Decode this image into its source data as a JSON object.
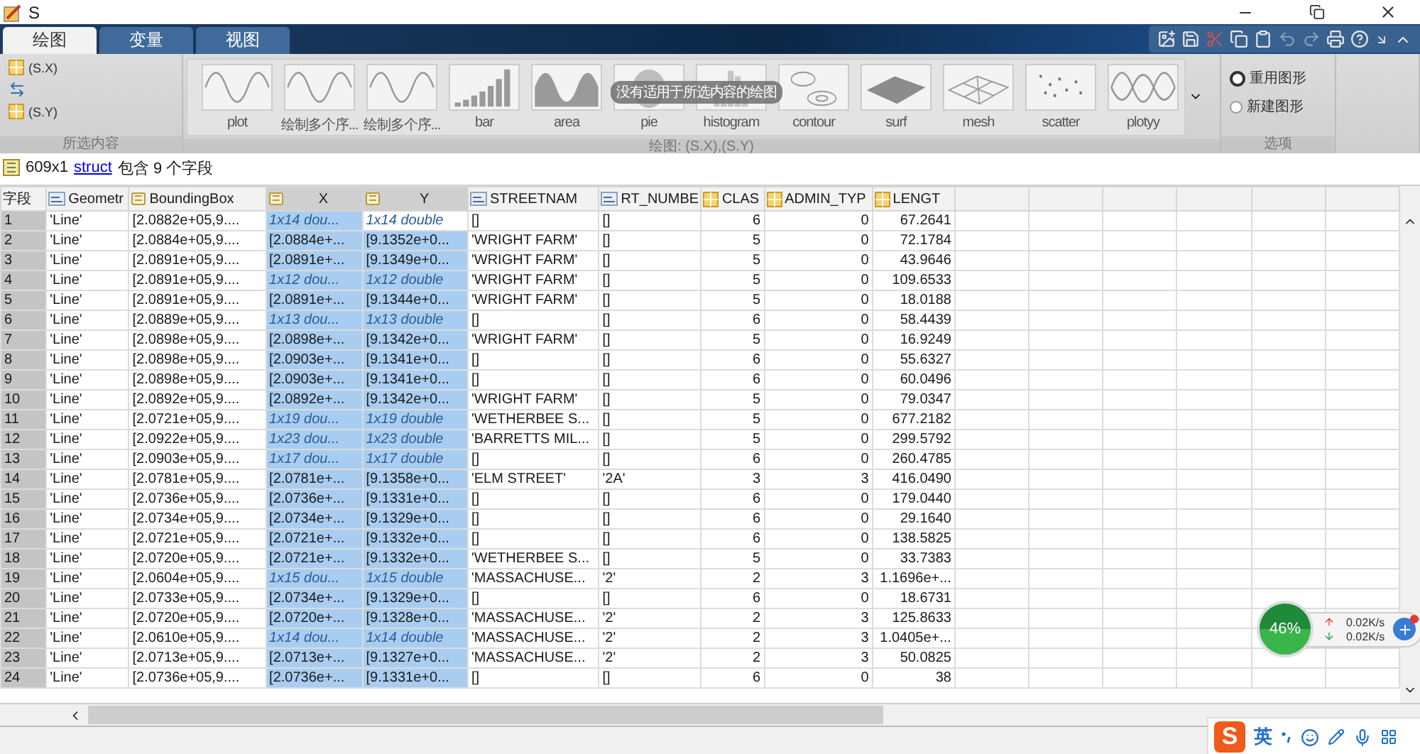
{
  "window": {
    "title": "S"
  },
  "tabs": [
    {
      "label": "绘图",
      "selected": true
    },
    {
      "label": "变量",
      "selected": false
    },
    {
      "label": "视图",
      "selected": false
    }
  ],
  "selection": {
    "items": [
      "(S.X)",
      "(S.Y)"
    ],
    "label": "所选内容"
  },
  "gallery": {
    "label": "绘图: (S.X),(S.Y)",
    "tooltip": "没有适用于所选内容的绘图",
    "items": [
      {
        "label": "plot",
        "kind": "plot"
      },
      {
        "label": "绘制多个序...",
        "kind": "plot"
      },
      {
        "label": "绘制多个序...",
        "kind": "plot"
      },
      {
        "label": "bar",
        "kind": "bar"
      },
      {
        "label": "area",
        "kind": "area"
      },
      {
        "label": "pie",
        "kind": "pie"
      },
      {
        "label": "histogram",
        "kind": "histogram"
      },
      {
        "label": "contour",
        "kind": "contour"
      },
      {
        "label": "surf",
        "kind": "surf"
      },
      {
        "label": "mesh",
        "kind": "mesh"
      },
      {
        "label": "scatter",
        "kind": "scatter"
      },
      {
        "label": "plotyy",
        "kind": "plotyy"
      }
    ]
  },
  "options": {
    "label": "选项",
    "radios": [
      {
        "label": "重用图形",
        "selected": true
      },
      {
        "label": "新建图形",
        "selected": false
      }
    ]
  },
  "info": {
    "size": "609x1",
    "link": "struct",
    "text": "包含 9 个字段"
  },
  "table": {
    "columns": [
      {
        "label": "字段",
        "kind": "index",
        "selected": false
      },
      {
        "label": "Geometr",
        "kind": "char",
        "selected": false
      },
      {
        "label": "BoundingBox",
        "kind": "cell",
        "selected": false
      },
      {
        "label": "X",
        "kind": "cell",
        "selected": true
      },
      {
        "label": "Y",
        "kind": "cell",
        "selected": true
      },
      {
        "label": "STREETNAM",
        "kind": "char",
        "selected": false
      },
      {
        "label": "RT_NUMBE",
        "kind": "char",
        "selected": false
      },
      {
        "label": "CLAS",
        "kind": "numeric",
        "selected": false
      },
      {
        "label": "ADMIN_TYP",
        "kind": "numeric",
        "selected": false
      },
      {
        "label": "LENGT",
        "kind": "numeric",
        "selected": false
      }
    ],
    "rows": [
      {
        "kind": "size",
        "focused": true,
        "cells": [
          "1",
          "'Line'",
          "[2.0882e+05,9....",
          "1x14 dou...",
          "1x14 double",
          "[]",
          "[]",
          "6",
          "0",
          "67.2641"
        ]
      },
      {
        "kind": "value",
        "focused": false,
        "cells": [
          "2",
          "'Line'",
          "[2.0884e+05,9....",
          "[2.0884e+...",
          "[9.1352e+0...",
          "'WRIGHT FARM'",
          "[]",
          "5",
          "0",
          "72.1784"
        ]
      },
      {
        "kind": "value",
        "focused": false,
        "cells": [
          "3",
          "'Line'",
          "[2.0891e+05,9....",
          "[2.0891e+...",
          "[9.1349e+0...",
          "'WRIGHT FARM'",
          "[]",
          "5",
          "0",
          "43.9646"
        ]
      },
      {
        "kind": "size",
        "focused": false,
        "cells": [
          "4",
          "'Line'",
          "[2.0891e+05,9....",
          "1x12 dou...",
          "1x12 double",
          "'WRIGHT FARM'",
          "[]",
          "5",
          "0",
          "109.6533"
        ]
      },
      {
        "kind": "value",
        "focused": false,
        "cells": [
          "5",
          "'Line'",
          "[2.0891e+05,9....",
          "[2.0891e+...",
          "[9.1344e+0...",
          "'WRIGHT FARM'",
          "[]",
          "5",
          "0",
          "18.0188"
        ]
      },
      {
        "kind": "size",
        "focused": false,
        "cells": [
          "6",
          "'Line'",
          "[2.0889e+05,9....",
          "1x13 dou...",
          "1x13 double",
          "[]",
          "[]",
          "6",
          "0",
          "58.4439"
        ]
      },
      {
        "kind": "value",
        "focused": false,
        "cells": [
          "7",
          "'Line'",
          "[2.0898e+05,9....",
          "[2.0898e+...",
          "[9.1342e+0...",
          "'WRIGHT FARM'",
          "[]",
          "5",
          "0",
          "16.9249"
        ]
      },
      {
        "kind": "value",
        "focused": false,
        "cells": [
          "8",
          "'Line'",
          "[2.0898e+05,9....",
          "[2.0903e+...",
          "[9.1341e+0...",
          "[]",
          "[]",
          "6",
          "0",
          "55.6327"
        ]
      },
      {
        "kind": "value",
        "focused": false,
        "cells": [
          "9",
          "'Line'",
          "[2.0898e+05,9....",
          "[2.0903e+...",
          "[9.1341e+0...",
          "[]",
          "[]",
          "6",
          "0",
          "60.0496"
        ]
      },
      {
        "kind": "value",
        "focused": false,
        "cells": [
          "10",
          "'Line'",
          "[2.0892e+05,9....",
          "[2.0892e+...",
          "[9.1342e+0...",
          "'WRIGHT FARM'",
          "[]",
          "5",
          "0",
          "79.0347"
        ]
      },
      {
        "kind": "size",
        "focused": false,
        "cells": [
          "11",
          "'Line'",
          "[2.0721e+05,9....",
          "1x19 dou...",
          "1x19 double",
          "'WETHERBEE S...",
          "[]",
          "5",
          "0",
          "677.2182"
        ]
      },
      {
        "kind": "size",
        "focused": false,
        "cells": [
          "12",
          "'Line'",
          "[2.0922e+05,9....",
          "1x23 dou...",
          "1x23 double",
          "'BARRETTS MIL...",
          "[]",
          "5",
          "0",
          "299.5792"
        ]
      },
      {
        "kind": "size",
        "focused": false,
        "cells": [
          "13",
          "'Line'",
          "[2.0903e+05,9....",
          "1x17 dou...",
          "1x17 double",
          "[]",
          "[]",
          "6",
          "0",
          "260.4785"
        ]
      },
      {
        "kind": "value",
        "focused": false,
        "cells": [
          "14",
          "'Line'",
          "[2.0781e+05,9....",
          "[2.0781e+...",
          "[9.1358e+0...",
          "'ELM STREET'",
          "'2A'",
          "3",
          "3",
          "416.0490"
        ]
      },
      {
        "kind": "value",
        "focused": false,
        "cells": [
          "15",
          "'Line'",
          "[2.0736e+05,9....",
          "[2.0736e+...",
          "[9.1331e+0...",
          "[]",
          "[]",
          "6",
          "0",
          "179.0440"
        ]
      },
      {
        "kind": "value",
        "focused": false,
        "cells": [
          "16",
          "'Line'",
          "[2.0734e+05,9....",
          "[2.0734e+...",
          "[9.1329e+0...",
          "[]",
          "[]",
          "6",
          "0",
          "29.1640"
        ]
      },
      {
        "kind": "value",
        "focused": false,
        "cells": [
          "17",
          "'Line'",
          "[2.0721e+05,9....",
          "[2.0721e+...",
          "[9.1332e+0...",
          "[]",
          "[]",
          "6",
          "0",
          "138.5825"
        ]
      },
      {
        "kind": "value",
        "focused": false,
        "cells": [
          "18",
          "'Line'",
          "[2.0720e+05,9....",
          "[2.0721e+...",
          "[9.1332e+0...",
          "'WETHERBEE S...",
          "[]",
          "5",
          "0",
          "33.7383"
        ]
      },
      {
        "kind": "size",
        "focused": false,
        "cells": [
          "19",
          "'Line'",
          "[2.0604e+05,9....",
          "1x15 dou...",
          "1x15 double",
          "'MASSACHUSE...",
          "'2'",
          "2",
          "3",
          "1.1696e+..."
        ]
      },
      {
        "kind": "value",
        "focused": false,
        "cells": [
          "20",
          "'Line'",
          "[2.0733e+05,9....",
          "[2.0734e+...",
          "[9.1329e+0...",
          "[]",
          "[]",
          "6",
          "0",
          "18.6731"
        ]
      },
      {
        "kind": "value",
        "focused": false,
        "cells": [
          "21",
          "'Line'",
          "[2.0720e+05,9....",
          "[2.0720e+...",
          "[9.1328e+0...",
          "'MASSACHUSE...",
          "'2'",
          "2",
          "3",
          "125.8633"
        ]
      },
      {
        "kind": "size",
        "focused": false,
        "cells": [
          "22",
          "'Line'",
          "[2.0610e+05,9....",
          "1x14 dou...",
          "1x14 double",
          "'MASSACHUSE...",
          "'2'",
          "2",
          "3",
          "1.0405e+..."
        ]
      },
      {
        "kind": "value",
        "focused": false,
        "cells": [
          "23",
          "'Line'",
          "[2.0713e+05,9....",
          "[2.0713e+...",
          "[9.1327e+0...",
          "'MASSACHUSE...",
          "'2'",
          "2",
          "3",
          "50.0825"
        ]
      },
      {
        "kind": "value",
        "focused": false,
        "cells": [
          "24",
          "'Line'",
          "[2.0736e+05,9....",
          "[2.0736e+...",
          "[9.1331e+0...",
          "[]",
          "[]",
          "6",
          "0",
          "38"
        ]
      }
    ]
  },
  "network": {
    "percent": "46%",
    "up": "0.02K/s",
    "down": "0.02K/s"
  },
  "ime": {
    "logo": "S",
    "mode": "英"
  }
}
